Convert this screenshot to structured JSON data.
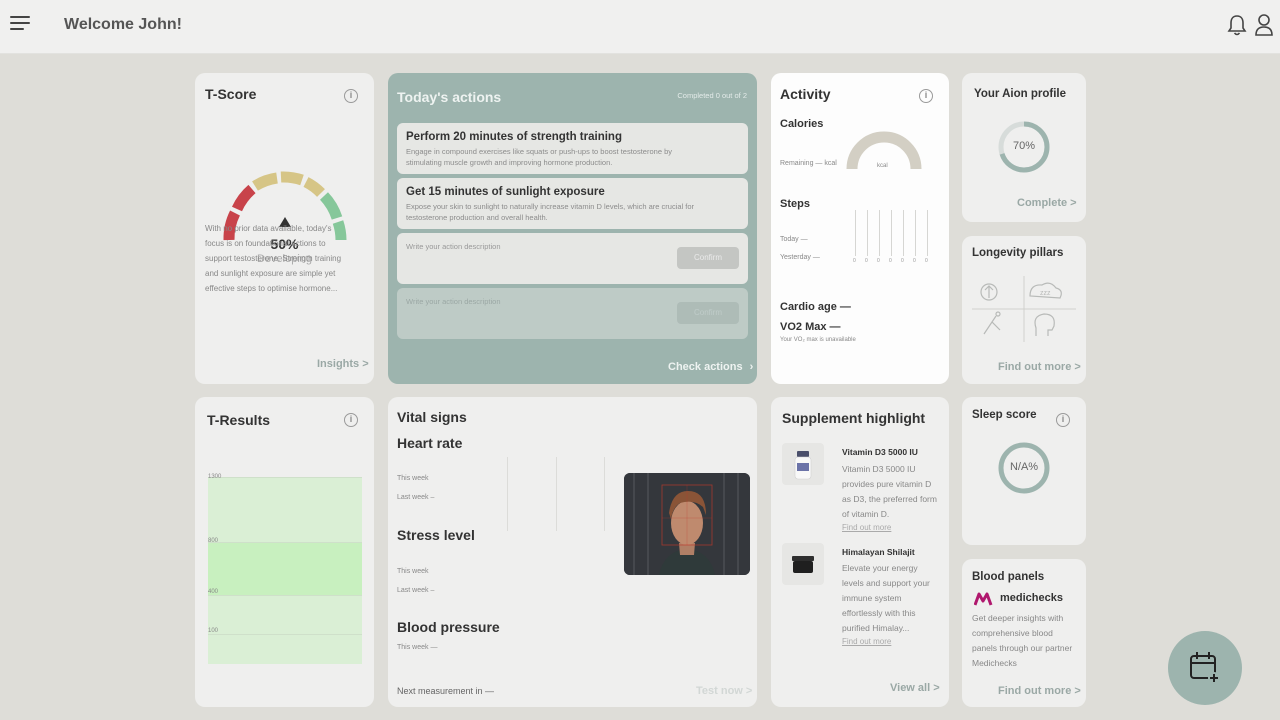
{
  "header": {
    "welcome": "Welcome John!"
  },
  "tscore": {
    "title": "T-Score",
    "percent": "50%",
    "status": "Developing",
    "description": "With no prior data available, today's focus is on foundational actions to support testosterone. Strength training and sunlight exposure are simple yet effective steps to optimise hormone...",
    "link": "Insights >"
  },
  "actions": {
    "title": "Today's actions",
    "completed": "Completed 0 out of 2",
    "items": [
      {
        "title": "Perform 20 minutes of strength training",
        "desc": "Engage in compound exercises like squats or push-ups to boost testosterone by stimulating muscle growth and improving hormone production."
      },
      {
        "title": "Get 15 minutes of sunlight exposure",
        "desc": "Expose your skin to sunlight to naturally increase vitamin D levels, which are crucial for testosterone production and overall health."
      }
    ],
    "input_placeholder": "Write your action description",
    "confirm": "Confirm",
    "link": "Check actions"
  },
  "activity": {
    "title": "Activity",
    "calories": "Calories",
    "remaining": "Remaining — kcal",
    "kcal": "kcal",
    "steps": "Steps",
    "today": "Today —",
    "yesterday": "Yesterday —",
    "step_ticks": [
      "0",
      "0",
      "0",
      "0",
      "0",
      "0",
      "0"
    ],
    "cardio": "Cardio age —",
    "vo2": "VO2 Max —",
    "vo2_note": "Your VO₂ max is unavailable"
  },
  "aion": {
    "title": "Your Aion profile",
    "percent": "70%",
    "progress": 0.7,
    "link": "Complete >"
  },
  "longevity": {
    "title": "Longevity pillars",
    "link": "Find out more >"
  },
  "tresults": {
    "title": "T-Results",
    "ticks": [
      "1300",
      "800",
      "400",
      "100"
    ]
  },
  "vitals": {
    "title": "Vital signs",
    "heart": "Heart rate",
    "this_week": "This week",
    "last_week": "Last week –",
    "stress": "Stress level",
    "bp": "Blood pressure",
    "bp_this_week": "This week —",
    "next": "Next measurement in —",
    "link": "Test now >"
  },
  "supplement": {
    "title": "Supplement highlight",
    "items": [
      {
        "name": "Vitamin D3 5000 IU",
        "desc": "Vitamin D3 5000 IU provides pure vitamin D as D3, the preferred form of vitamin D.",
        "link": "Find out more"
      },
      {
        "name": "Himalayan Shilajit",
        "desc": "Elevate your energy levels and support your immune system effortlessly with this purified Himalay...",
        "link": "Find out more"
      }
    ],
    "link": "View all >"
  },
  "sleep": {
    "title": "Sleep score",
    "value": "N/A%"
  },
  "blood": {
    "title": "Blood panels",
    "brand": "medichecks",
    "desc": "Get deeper insights with comprehensive blood panels through our partner Medichecks",
    "link": "Find out more >"
  },
  "colors": {
    "accent": "#9db4ae",
    "red": "#c8434a",
    "yellow": "#d6c586",
    "green": "#86c79a"
  }
}
